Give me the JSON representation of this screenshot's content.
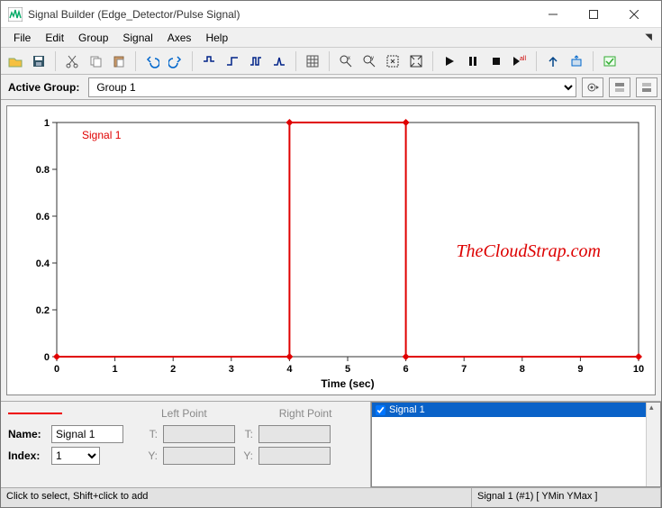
{
  "window": {
    "title": "Signal Builder (Edge_Detector/Pulse Signal)"
  },
  "menus": [
    "File",
    "Edit",
    "Group",
    "Signal",
    "Axes",
    "Help"
  ],
  "active_group": {
    "label": "Active Group:",
    "value": "Group 1"
  },
  "chart_data": {
    "type": "line",
    "title": "",
    "series_name": "Signal 1",
    "xlabel": "Time (sec)",
    "ylabel": "",
    "xlim": [
      0,
      10
    ],
    "ylim": [
      0,
      1
    ],
    "xticks": [
      0,
      1,
      2,
      3,
      4,
      5,
      6,
      7,
      8,
      9,
      10
    ],
    "yticks": [
      0,
      0.2,
      0.4,
      0.6,
      0.8,
      1
    ],
    "x": [
      0,
      4,
      4,
      6,
      6,
      10
    ],
    "y": [
      0,
      0,
      1,
      1,
      0,
      0
    ],
    "markers_x": [
      0,
      4,
      4,
      6,
      6,
      10
    ],
    "markers_y": [
      0,
      0,
      1,
      1,
      0,
      0
    ],
    "color": "#e00000"
  },
  "watermark": "TheCloudStrap.com",
  "editor": {
    "lp_label": "Left Point",
    "rp_label": "Right Point",
    "name_label": "Name:",
    "index_label": "Index:",
    "t_label": "T:",
    "y_label": "Y:",
    "name_value": "Signal 1",
    "index_value": "1",
    "list_item": "Signal 1"
  },
  "status": {
    "left": "Click to select, Shift+click to add",
    "right": "Signal 1 (#1)  [ YMin YMax ]"
  }
}
